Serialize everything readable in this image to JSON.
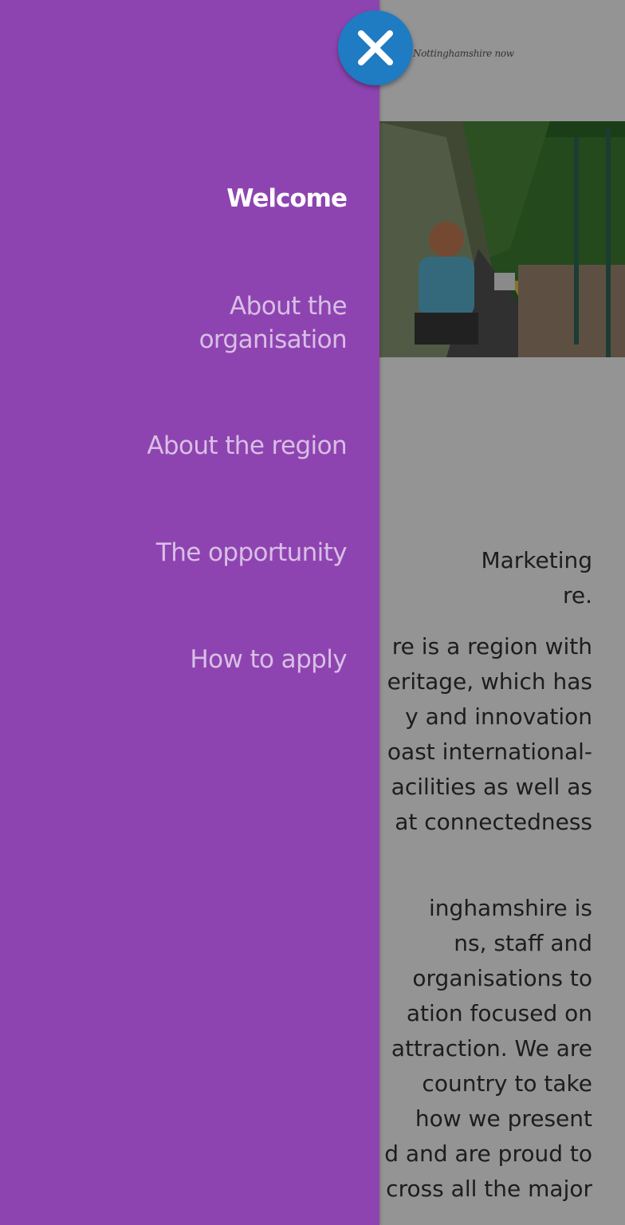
{
  "site": {
    "logo_text": "Nottinghamshire now"
  },
  "menu": {
    "items": [
      {
        "label": "Welcome",
        "active": true
      },
      {
        "label_lines": [
          "About the",
          "organisation"
        ],
        "active": false
      },
      {
        "label": "About the region",
        "active": false
      },
      {
        "label": "The opportunity",
        "active": false
      },
      {
        "label": "How to apply",
        "active": false
      }
    ],
    "close_icon": "close-icon"
  },
  "article": {
    "intro_lines": [
      "Marketing",
      "re."
    ],
    "paragraph1_lines": [
      "re is a region with",
      "eritage, which has",
      "y and innovation",
      "oast international-",
      "acilities as well as",
      "at connectedness"
    ],
    "paragraph2_lines": [
      "inghamshire is",
      "ns, staff and",
      "organisations to",
      "ation focused on",
      "attraction. We are",
      "country to take",
      " how we present",
      "d and are proud to",
      "cross all the major"
    ]
  },
  "colors": {
    "menu_background": "#8e44b0",
    "menu_text_inactive": "#d8bfe6",
    "menu_text_active": "#ffffff",
    "close_button": "#1f7bc2",
    "overlay": "rgba(0,0,0,0.42)"
  }
}
